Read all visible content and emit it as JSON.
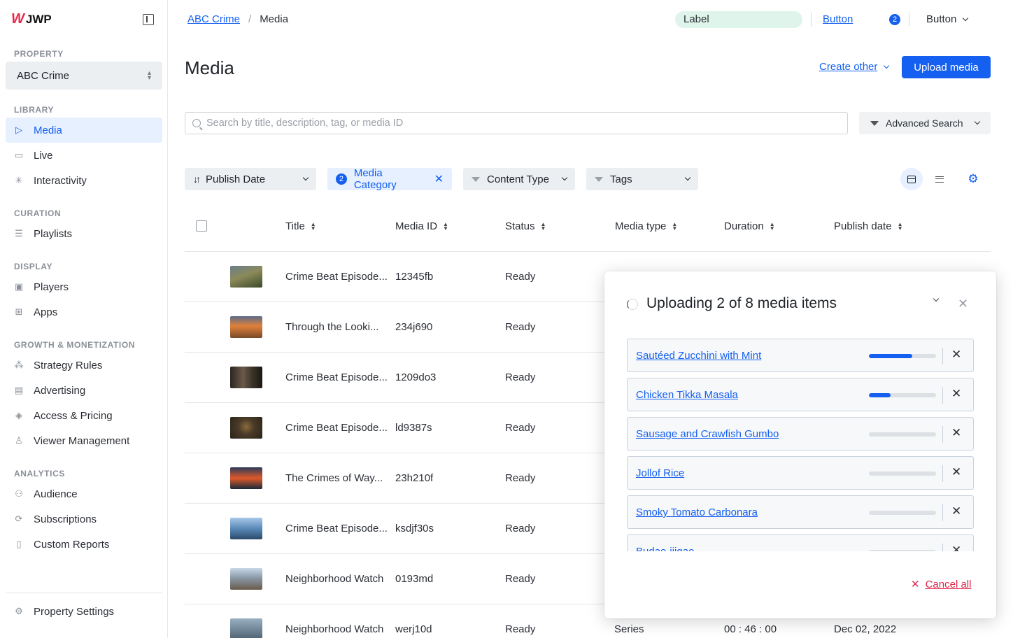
{
  "app": {
    "logo_text": "JWP",
    "accent": "#1560f0",
    "brand": "#e8284a"
  },
  "sidebar": {
    "property_section": "PROPERTY",
    "property_value": "ABC Crime",
    "sections": [
      {
        "title": "LIBRARY",
        "items": [
          {
            "label": "Media",
            "icon": "play-icon",
            "active": true
          },
          {
            "label": "Live",
            "icon": "video-camera-icon"
          },
          {
            "label": "Interactivity",
            "icon": "sparkle-icon"
          }
        ]
      },
      {
        "title": "CURATION",
        "items": [
          {
            "label": "Playlists",
            "icon": "playlist-icon"
          }
        ]
      },
      {
        "title": "DISPLAY",
        "items": [
          {
            "label": "Players",
            "icon": "player-icon"
          },
          {
            "label": "Apps",
            "icon": "apps-grid-icon"
          }
        ]
      },
      {
        "title": "GROWTH & MONETIZATION",
        "items": [
          {
            "label": "Strategy Rules",
            "icon": "strategy-icon"
          },
          {
            "label": "Advertising",
            "icon": "ad-icon"
          },
          {
            "label": "Access & Pricing",
            "icon": "tag-icon"
          },
          {
            "label": "Viewer Management",
            "icon": "user-icon"
          }
        ]
      },
      {
        "title": "ANALYTICS",
        "items": [
          {
            "label": "Audience",
            "icon": "audience-icon"
          },
          {
            "label": "Subscriptions",
            "icon": "subscription-icon"
          },
          {
            "label": "Custom Reports",
            "icon": "clipboard-icon"
          }
        ]
      }
    ],
    "settings_label": "Property Settings"
  },
  "topbar": {
    "breadcrumb_parent": "ABC Crime",
    "breadcrumb_sep": "/",
    "breadcrumb_current": "Media",
    "label": "Label",
    "button_link": "Button",
    "notification_count": "2",
    "dropdown_label": "Button"
  },
  "header": {
    "title": "Media",
    "create_other": "Create other",
    "upload_button": "Upload media"
  },
  "search": {
    "placeholder": "Search by title, description, tag, or media ID",
    "value": "",
    "advanced": "Advanced Search"
  },
  "filters": {
    "sort_label": "Publish Date",
    "category_count": "2",
    "category_label": "Media Category",
    "content_type": "Content Type",
    "tags": "Tags"
  },
  "table": {
    "columns": [
      "Title",
      "Media ID",
      "Status",
      "Media type",
      "Duration",
      "Publish date"
    ],
    "rows": [
      {
        "title": "Crime Beat Episode...",
        "id": "12345fb",
        "status": "Ready",
        "media_type": "",
        "duration": "",
        "date": ""
      },
      {
        "title": "Through the Looki...",
        "id": "234j690",
        "status": "Ready",
        "media_type": "",
        "duration": "",
        "date": ""
      },
      {
        "title": "Crime Beat Episode...",
        "id": "1209do3",
        "status": "Ready",
        "media_type": "",
        "duration": "",
        "date": ""
      },
      {
        "title": "Crime Beat Episode...",
        "id": "ld9387s",
        "status": "Ready",
        "media_type": "",
        "duration": "",
        "date": ""
      },
      {
        "title": "The Crimes of Way...",
        "id": "23h210f",
        "status": "Ready",
        "media_type": "",
        "duration": "",
        "date": ""
      },
      {
        "title": "Crime Beat Episode...",
        "id": "ksdjf30s",
        "status": "Ready",
        "media_type": "",
        "duration": "",
        "date": ""
      },
      {
        "title": "Neighborhood Watch",
        "id": "0193md",
        "status": "Ready",
        "media_type": "",
        "duration": "",
        "date": ""
      },
      {
        "title": "Neighborhood Watch",
        "id": "werj10d",
        "status": "Ready",
        "media_type": "Series",
        "duration": "00 : 46 : 00",
        "date": "Dec 02, 2022"
      }
    ]
  },
  "upload_panel": {
    "title": "Uploading 2 of 8 media items",
    "items": [
      {
        "name": "Sautéed Zucchini with Mint",
        "progress": 0.65
      },
      {
        "name": "Chicken Tikka Masala",
        "progress": 0.32
      },
      {
        "name": "Sausage and Crawfish Gumbo",
        "progress": 0
      },
      {
        "name": "Jollof Rice",
        "progress": 0
      },
      {
        "name": "Smoky Tomato Carbonara",
        "progress": 0
      },
      {
        "name": "Budae-jjigae",
        "progress": 0
      }
    ],
    "cancel_all": "Cancel all"
  }
}
